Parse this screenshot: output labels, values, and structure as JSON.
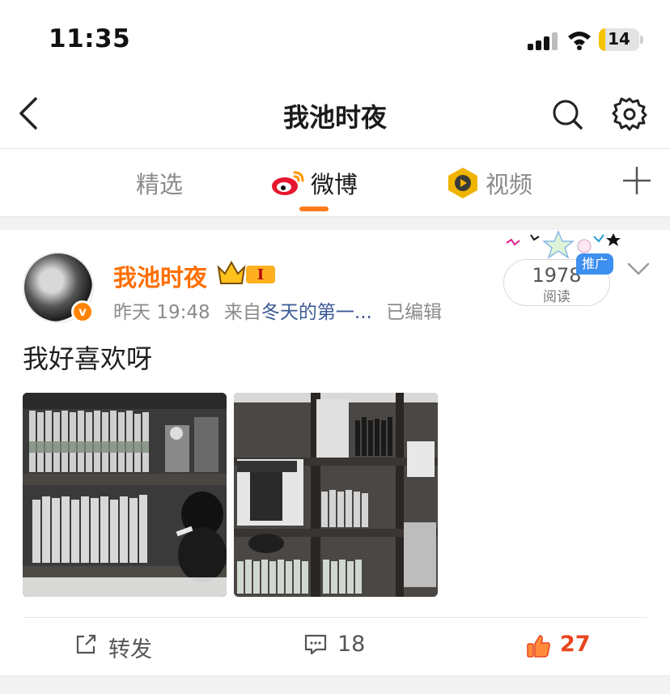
{
  "status_bar": {
    "time": "11:35",
    "battery": "14"
  },
  "nav": {
    "title": "我池时夜"
  },
  "tabs": [
    {
      "label": "精选",
      "selected": false
    },
    {
      "label": "微博",
      "selected": true
    },
    {
      "label": "视频",
      "selected": false
    }
  ],
  "post": {
    "author": "我池时夜",
    "level_badge": "I",
    "time": "昨天 19:48",
    "source_prefix": "来自",
    "source": "冬天的第一...",
    "edited": "已编辑",
    "reads": "1978",
    "reads_label": "阅读",
    "promo_label": "推广",
    "text": "我好喜欢呀",
    "actions": {
      "repost_label": "转发",
      "comments": "18",
      "likes": "27"
    }
  },
  "colors": {
    "accent": "#ff7a1a",
    "author": "#ff6e00",
    "like": "#e8461f",
    "link": "#3c5a96"
  }
}
